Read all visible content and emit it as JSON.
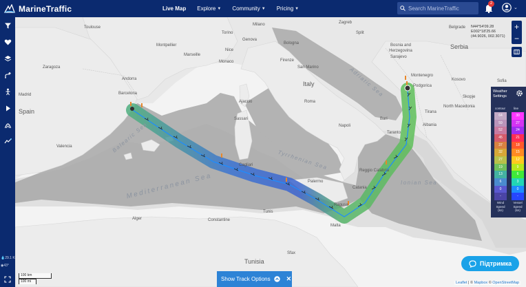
{
  "header": {
    "brand": "MarineTraffic",
    "nav": [
      {
        "label": "Live Map",
        "caret": false
      },
      {
        "label": "Explore",
        "caret": true
      },
      {
        "label": "Community",
        "caret": true
      },
      {
        "label": "Pricing",
        "caret": true
      }
    ],
    "search_placeholder": "Search MarineTraffic",
    "notifications_count": "2"
  },
  "sidebar": {
    "icons": [
      "filter-icon",
      "heart-icon",
      "layers-icon",
      "route-icon",
      "people-icon",
      "play-icon",
      "aurora-icon",
      "wind-graph-icon"
    ],
    "readouts": [
      "29.1 K",
      "43°"
    ]
  },
  "map": {
    "coordinates": [
      "N44°54'09.28",
      "E002°18'25.66",
      "(44.9026, 002.3071)"
    ],
    "countries": [
      "Spain",
      "Andorra",
      "Monaco",
      "Italy",
      "Bosnia and Herzegovina",
      "Serbia",
      "Kosovo",
      "North Macedonia",
      "Albania",
      "Tunisia",
      "Malta",
      "Montenegro",
      "San Marino"
    ],
    "seas": [
      "Balearic Sea",
      "Mediterranean Sea",
      "Tyrrhenian Sea",
      "Adriatic Sea",
      "Ionian Sea"
    ],
    "cities": [
      "Toulouse",
      "Montpellier",
      "Marseille",
      "Nice",
      "Genova",
      "Milano",
      "Torino",
      "Firenze",
      "Bologna",
      "Roma",
      "Napoli",
      "Bari",
      "Valencia",
      "Palermo",
      "Catania",
      "Tirana",
      "Sarajevo",
      "Podgorica",
      "Sofia",
      "Skopje",
      "Alger",
      "Tunis",
      "Zaragoza",
      "Madrid",
      "Barcelona",
      "Ajaccio",
      "Cagliari",
      "Sassari",
      "Taranto",
      "Reggio Calabria",
      "Split",
      "Zagreb",
      "Belgrade",
      "Constantine",
      "Sfax",
      "Ragusa",
      "Napoli"
    ],
    "scale": [
      "100 km",
      "100 mi"
    ]
  },
  "weather": {
    "title": "Weather Settings",
    "contour_label": "contour",
    "line_label": "line",
    "contour_values": [
      "64",
      "59",
      "52",
      "45",
      "37",
      "32",
      "27",
      "19",
      "13",
      "6",
      "0",
      "-"
    ],
    "line_values": [
      "30",
      "27",
      "24",
      "21",
      "18",
      "15",
      "12",
      "9",
      "6",
      "3",
      "0",
      "-"
    ],
    "contour_footer": "Wind Speed (kn)",
    "line_footer": "Vessel Speed (kn)",
    "contour_colors": [
      "#c2a9c5",
      "#b993ba",
      "#c87aa0",
      "#d45b6b",
      "#d88140",
      "#d6a737",
      "#b7c04a",
      "#6fbf5d",
      "#43b2a2",
      "#4a8bcf",
      "#5a58cf",
      "#4a44a6"
    ],
    "line_colors": [
      "#ff36ff",
      "#d433f3",
      "#a12cf0",
      "#ff2d55",
      "#ff5a2b",
      "#ff8b22",
      "#ffc91f",
      "#b6e81c",
      "#3fe93a",
      "#22d6b5",
      "#1d8cff",
      "#2646ff"
    ]
  },
  "track": {
    "label": "Show Track Options"
  },
  "support": {
    "label": "Підтримка"
  },
  "attribution": {
    "leaflet": "Leaflet",
    "separator": " | © ",
    "mapbox": "Mapbox",
    "osm": "OpenStreetMap"
  },
  "colors": {
    "nav_bg": "#0b2a6f",
    "accent": "#2d83d6",
    "support": "#1aa2e8"
  }
}
